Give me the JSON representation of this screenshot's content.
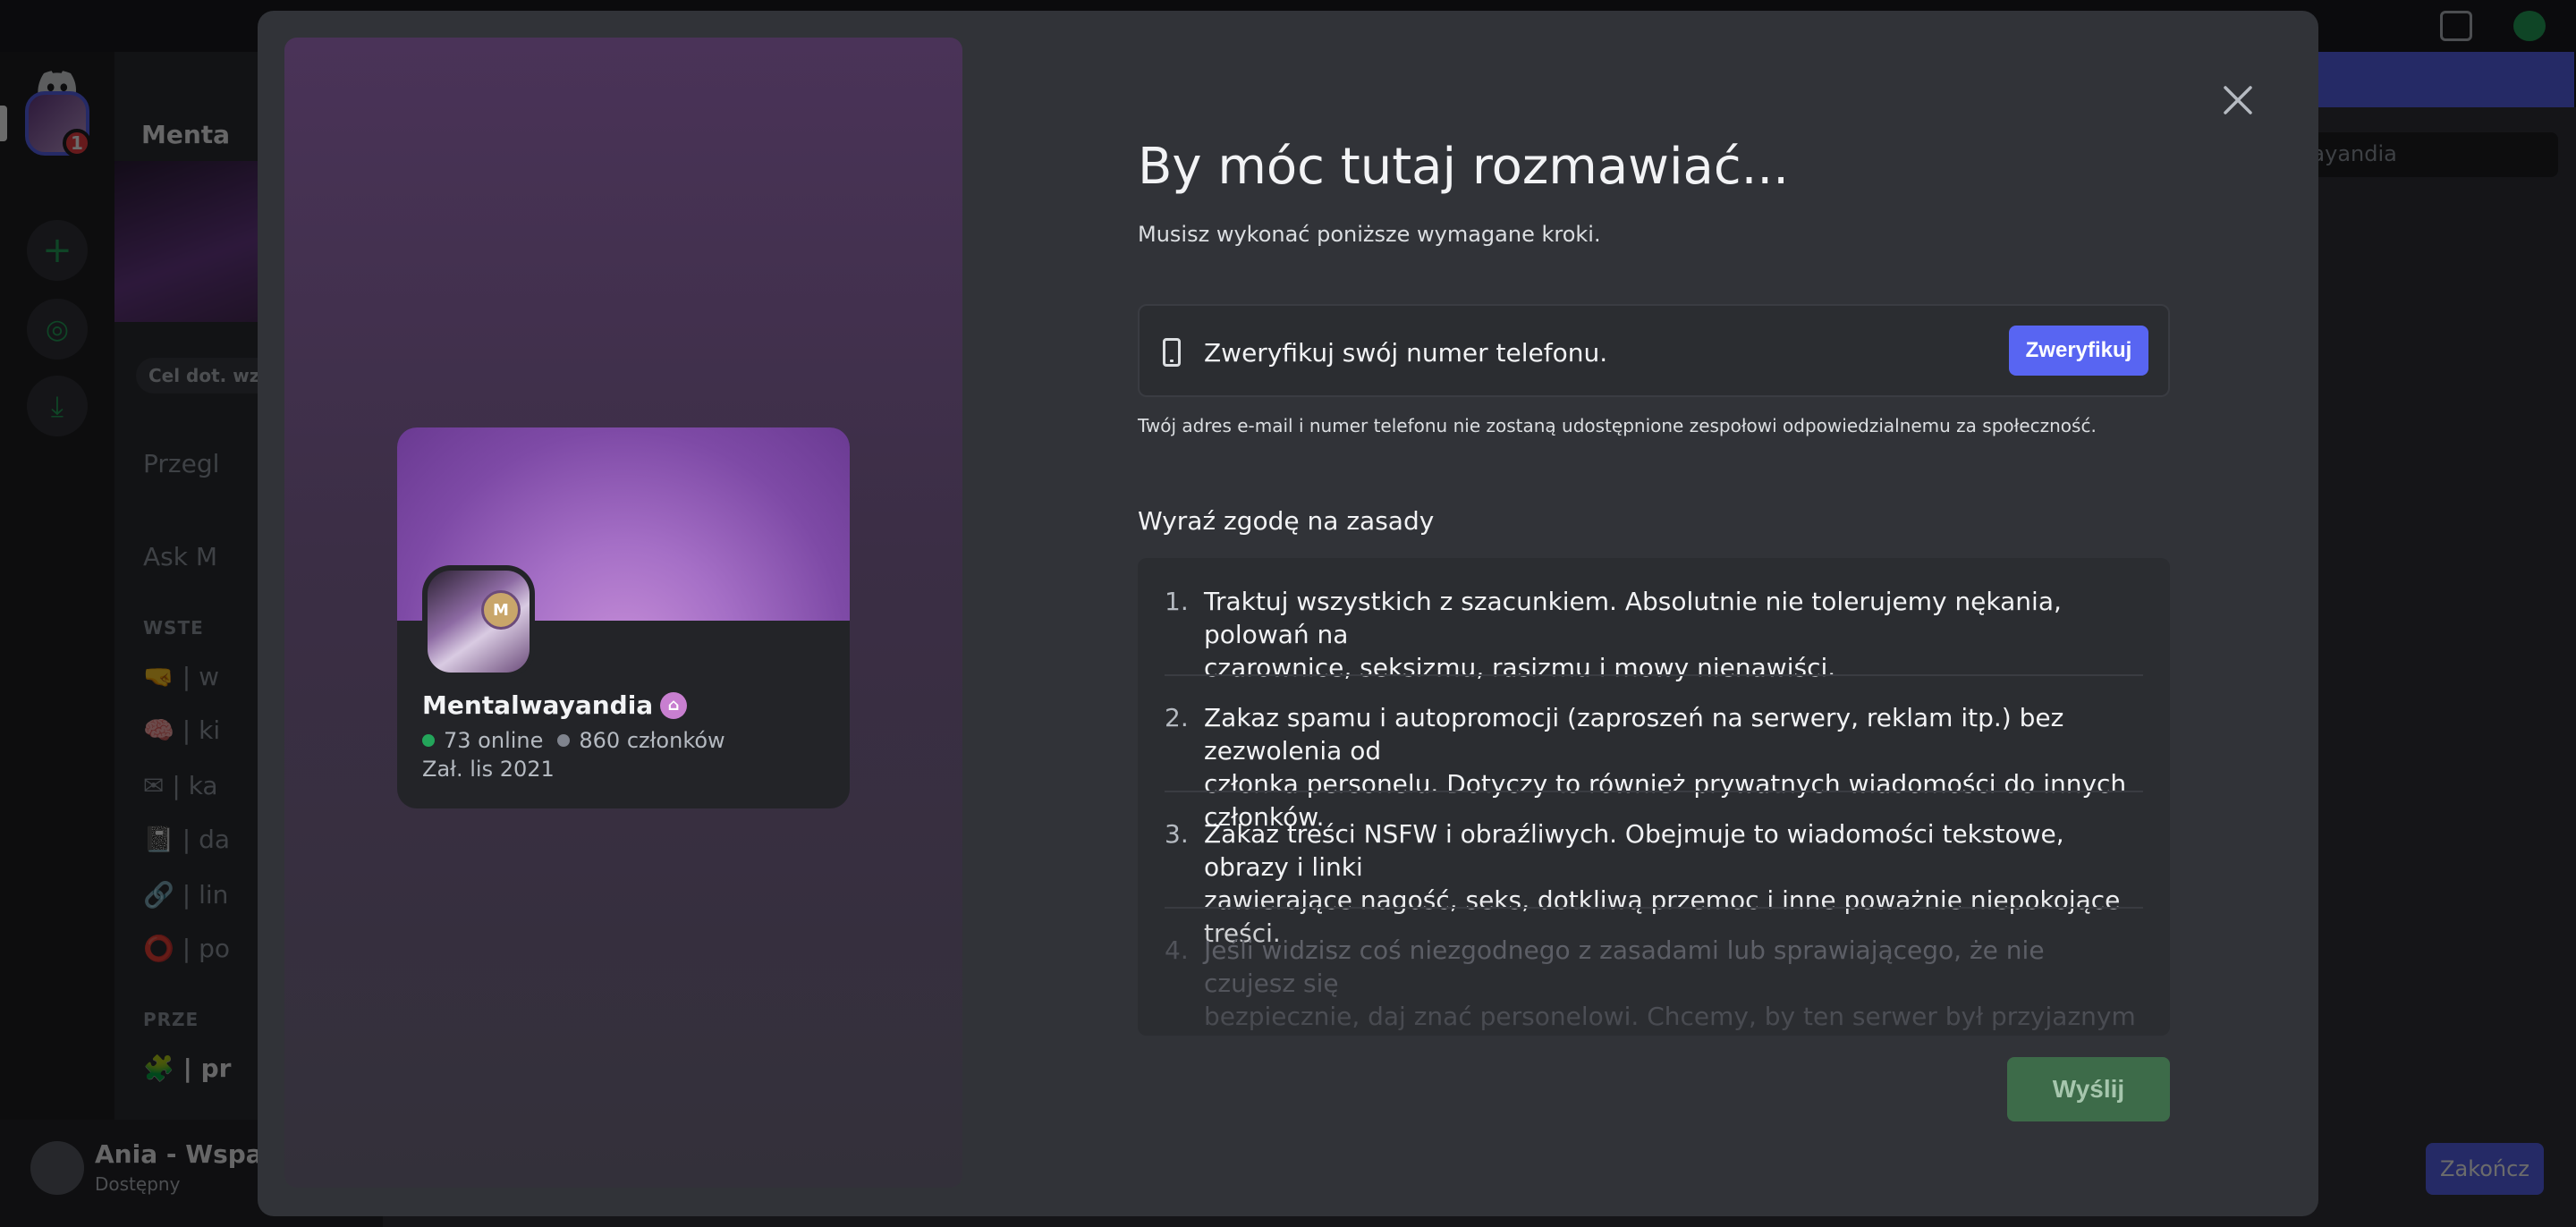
{
  "background": {
    "server_name": "Mentalwayandia",
    "server_header_short": "Menta",
    "goal_chip": "Cel dot. wzm",
    "search_placeholder": "talwayandia",
    "badge_count": "1",
    "channels": [
      {
        "label": "Przegl",
        "type": "channel"
      },
      {
        "label": "Ask M",
        "type": "channel"
      },
      {
        "label": "WSTE",
        "type": "category"
      },
      {
        "label": "🤜 | w",
        "type": "channel"
      },
      {
        "label": "🧠 | ki",
        "type": "channel"
      },
      {
        "label": "✉ | ka",
        "type": "channel"
      },
      {
        "label": "📓 | da",
        "type": "channel"
      },
      {
        "label": "🔗 | lin",
        "type": "channel"
      },
      {
        "label": "⭕ | po",
        "type": "channel"
      },
      {
        "label": "PRZE",
        "type": "category"
      },
      {
        "label": "🧩 | pr",
        "type": "channel"
      }
    ],
    "user_name": "Ania - Wsparci",
    "user_status": "Dostępny",
    "end_button": "Zakończ"
  },
  "modal": {
    "title": "By móc tutaj rozmawiać...",
    "subtitle": "Musisz wykonać poniższe wymagane kroki.",
    "verify": {
      "text": "Zweryfikuj swój numer telefonu.",
      "button": "Zweryfikuj"
    },
    "privacy_note": "Twój adres e-mail i numer telefonu nie zostaną udostępnione zespołowi odpowiedzialnemu za społeczność.",
    "rules_title": "Wyraź zgodę na zasady",
    "rules": [
      {
        "num": "1.",
        "line1": "Traktuj wszystkich z szacunkiem. Absolutnie nie tolerujemy nękania, polowań na",
        "line2": "czarownice, seksizmu, rasizmu i mowy nienawiści."
      },
      {
        "num": "2.",
        "line1": "Zakaz spamu i autopromocji (zaproszeń na serwery, reklam itp.) bez zezwolenia od",
        "line2": "członka personelu. Dotyczy to również prywatnych wiadomości do innych członków."
      },
      {
        "num": "3.",
        "line1": "Zakaz treści NSFW i obraźliwych. Obejmuje to wiadomości tekstowe, obrazy i linki",
        "line2": "zawierające nagość, seks, dotkliwą przemoc i inne poważnie niepokojące treści."
      },
      {
        "num": "4.",
        "line1": "Jeśli widzisz coś niezgodnego z zasadami lub sprawiającego, że nie czujesz się",
        "line2": "bezpiecznie, daj znać personelowi. Chcemy, by ten serwer był przyjaznym miejscem!"
      }
    ],
    "send_button": "Wyślij",
    "card": {
      "name": "Mentalwayandia",
      "online": "73 online",
      "members": "860 członków",
      "founded": "Zał. lis 2021",
      "icon_monogram": "M"
    }
  },
  "colors": {
    "blurple": "#5865f2",
    "green": "#23a55a",
    "send_disabled": "#3d6b49",
    "modal_bg": "#313338"
  }
}
